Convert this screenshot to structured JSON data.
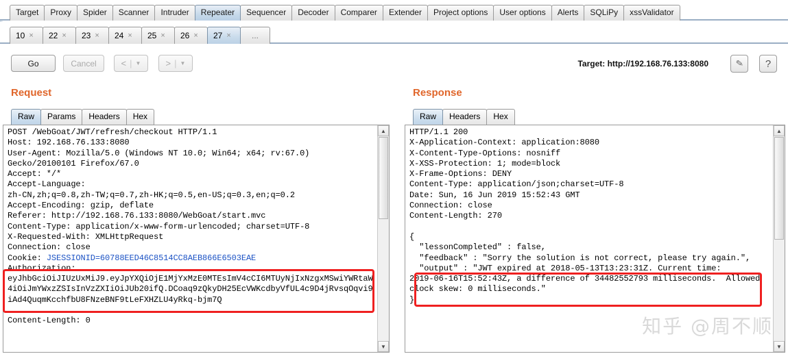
{
  "main_tabs": [
    {
      "label": "Target",
      "active": false
    },
    {
      "label": "Proxy",
      "active": false
    },
    {
      "label": "Spider",
      "active": false
    },
    {
      "label": "Scanner",
      "active": false
    },
    {
      "label": "Intruder",
      "active": false
    },
    {
      "label": "Repeater",
      "active": true
    },
    {
      "label": "Sequencer",
      "active": false
    },
    {
      "label": "Decoder",
      "active": false
    },
    {
      "label": "Comparer",
      "active": false
    },
    {
      "label": "Extender",
      "active": false
    },
    {
      "label": "Project options",
      "active": false
    },
    {
      "label": "User options",
      "active": false
    },
    {
      "label": "Alerts",
      "active": false
    },
    {
      "label": "SQLiPy",
      "active": false
    },
    {
      "label": "xssValidator",
      "active": false
    }
  ],
  "repeater_tabs": [
    {
      "label": "10",
      "active": false,
      "close": "×"
    },
    {
      "label": "22",
      "active": false,
      "close": "×"
    },
    {
      "label": "23",
      "active": false,
      "close": "×"
    },
    {
      "label": "24",
      "active": false,
      "close": "×"
    },
    {
      "label": "25",
      "active": false,
      "close": "×"
    },
    {
      "label": "26",
      "active": false,
      "close": "×"
    },
    {
      "label": "27",
      "active": true,
      "close": "×"
    }
  ],
  "repeater_tabs_more": "...",
  "toolbar": {
    "go_label": "Go",
    "cancel_label": "Cancel",
    "back_label": "<",
    "forward_label": ">",
    "caret": "▼",
    "separator": "|",
    "target_label": "Target: http://192.168.76.133:8080",
    "edit_target_icon": "✎",
    "help_label": "?"
  },
  "request": {
    "title": "Request",
    "tabs": [
      {
        "label": "Raw",
        "active": true
      },
      {
        "label": "Params",
        "active": false
      },
      {
        "label": "Headers",
        "active": false
      },
      {
        "label": "Hex",
        "active": false
      }
    ],
    "lines_before_cookie": "POST /WebGoat/JWT/refresh/checkout HTTP/1.1\nHost: 192.168.76.133:8080\nUser-Agent: Mozilla/5.0 (Windows NT 10.0; Win64; x64; rv:67.0)\nGecko/20100101 Firefox/67.0\nAccept: */*\nAccept-Language:\nzh-CN,zh;q=0.8,zh-TW;q=0.7,zh-HK;q=0.5,en-US;q=0.3,en;q=0.2\nAccept-Encoding: gzip, deflate\nReferer: http://192.168.76.133:8080/WebGoat/start.mvc\nContent-Type: application/x-www-form-urlencoded; charset=UTF-8\nX-Requested-With: XMLHttpRequest\nConnection: close\nCookie: ",
    "cookie_value": "JSESSIONID=60788EED46C8514CC8AEB866E6503EAE",
    "lines_after_cookie": "\nAuthorization:\neyJhbGciOiJIUzUxMiJ9.eyJpYXQiOjE1MjYxMzE0MTEsImV4cCI6MTUyNjIxNzgxMSwiYWRtaW\n4iOiJmYWxzZSIsInVzZXIiOiJUb20ifQ.DCoaq9zQkyDH25EcVWKcdbyVfUL4c9D4jRvsqOqvi9\niAd4QuqmKcchfbU8FNzeBNF9tLeFXHZLU4yRkq-bjm7Q\n\nContent-Length: 0"
  },
  "response": {
    "title": "Response",
    "tabs": [
      {
        "label": "Raw",
        "active": true
      },
      {
        "label": "Headers",
        "active": false
      },
      {
        "label": "Hex",
        "active": false
      }
    ],
    "body": "HTTP/1.1 200\nX-Application-Context: application:8080\nX-Content-Type-Options: nosniff\nX-XSS-Protection: 1; mode=block\nX-Frame-Options: DENY\nContent-Type: application/json;charset=UTF-8\nDate: Sun, 16 Jun 2019 15:52:43 GMT\nConnection: close\nContent-Length: 270\n\n{\n  \"lessonCompleted\" : false,\n  \"feedback\" : \"Sorry the solution is not correct, please try again.\",\n  \"output\" : \"JWT expired at 2018-05-13T13:23:31Z. Current time:\n2019-06-16T15:52:43Z, a difference of 34482552793 milliseconds.  Allowed\nclock skew: 0 milliseconds.\"\n}"
  },
  "watermark": "知乎 @周不顺",
  "colors": {
    "accent_orange": "#e0662b",
    "annotation_red": "#ef2020",
    "active_tab_blue": "#c6d9ea",
    "link_blue": "#1b52c4"
  }
}
